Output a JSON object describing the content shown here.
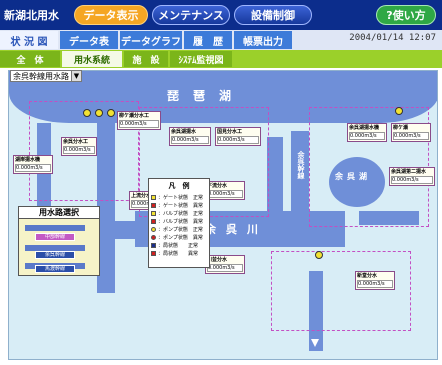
{
  "header": {
    "app_title": "新湖北用水",
    "tabs": [
      {
        "label": "データ表示",
        "active": true
      },
      {
        "label": "メンテナンス",
        "active": false
      },
      {
        "label": "設備制御",
        "active": false
      }
    ],
    "help_label": "?使い方"
  },
  "subnav": {
    "items": [
      {
        "label": "状 況 図",
        "active": true
      },
      {
        "label": "データ表",
        "active": false
      },
      {
        "label": "データグラフ",
        "active": false
      },
      {
        "label": "履　歴",
        "active": false
      },
      {
        "label": "帳票出力",
        "active": false
      }
    ],
    "datetime": "2004/01/14 12:07"
  },
  "viewtabs": {
    "items": [
      {
        "label": "全　体",
        "active": false
      },
      {
        "label": "用水系統",
        "active": true
      },
      {
        "label": "施　設",
        "active": false
      },
      {
        "label": "ｼｽﾃﾑ監視図",
        "active": false
      }
    ]
  },
  "canal_select": {
    "value": "余呉幹線用水路"
  },
  "map": {
    "lake_label": "琵琶湖",
    "river_label": "余呉川",
    "small_lake_label": "余呉湖",
    "canal_label": "余呉幹線"
  },
  "legend": {
    "title": "凡　例",
    "items": [
      {
        "label": "：ゲート状態　正常",
        "color": "#f2e232"
      },
      {
        "label": "：ゲート状態　異常",
        "color": "#d02020"
      },
      {
        "label": "：バルブ状態　正常",
        "color": "#f2e232"
      },
      {
        "label": "：バルブ状態　異常",
        "color": "#d02020"
      },
      {
        "label": "：ポンプ状態　正常",
        "color": "#f2e232"
      },
      {
        "label": "：ポンプ状態　異常",
        "color": "#d02020"
      },
      {
        "label": "：局状態　　正常",
        "color": "#1a2e8c"
      },
      {
        "label": "：局状態　　異常",
        "color": "#d02020"
      }
    ]
  },
  "minimap": {
    "title": "用水路選択",
    "routes": [
      "中部幹線",
      "余呉幹線",
      "馬渡幹線"
    ]
  },
  "stations": [
    {
      "name": "湖岸揚水機",
      "val": "0.000m3/s"
    },
    {
      "name": "余呉分水工",
      "val": "0.000m3/s"
    },
    {
      "name": "柳ケ瀬分水工",
      "val": "0.000m3/s"
    },
    {
      "name": "余呉湖揚水",
      "val": "0.000m3/s"
    },
    {
      "name": "国見分水工",
      "val": "0.000m3/s"
    },
    {
      "name": "上流分水",
      "val": "0.000m3/s"
    },
    {
      "name": "下流分水",
      "val": "0.000m3/s"
    },
    {
      "name": "余呉湖揚水機",
      "val": "0.000m3/s"
    },
    {
      "name": "柳ケ瀬",
      "val": "0.000m3/s"
    },
    {
      "name": "川並分水",
      "val": "0.000m3/s"
    },
    {
      "name": "余呉湖第二揚水",
      "val": "0.000m3/s"
    },
    {
      "name": "新堂分水",
      "val": "0.000m3/s"
    }
  ]
}
